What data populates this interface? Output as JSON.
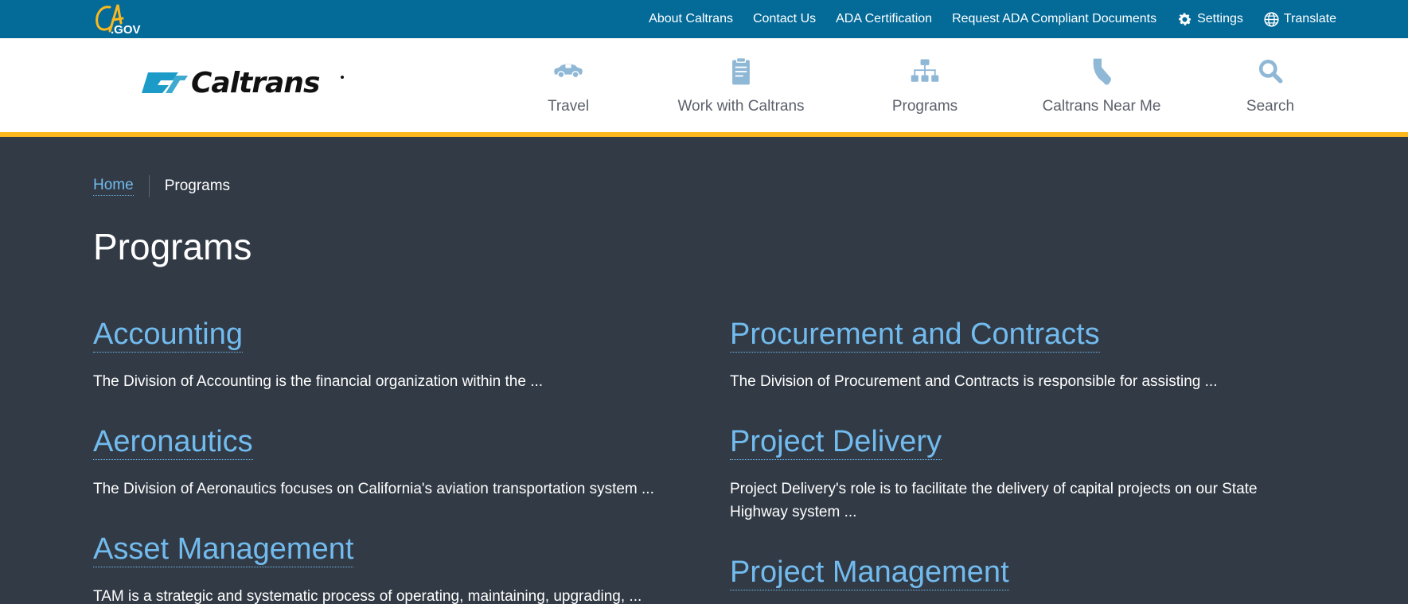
{
  "utility": {
    "links": [
      {
        "label": "About Caltrans"
      },
      {
        "label": "Contact Us"
      },
      {
        "label": "ADA Certification"
      },
      {
        "label": "Request ADA Compliant Documents"
      },
      {
        "label": "Settings",
        "icon": "gear-icon"
      },
      {
        "label": "Translate",
        "icon": "globe-icon"
      }
    ]
  },
  "colors": {
    "utility_bar": "#046b99",
    "gold_accent": "#fdb81e",
    "page_background": "#323a45",
    "link": "#72bbee",
    "nav_icon": "#8fb7d6"
  },
  "nav": {
    "items": [
      {
        "label": "Travel",
        "icon": "car-icon"
      },
      {
        "label": "Work with Caltrans",
        "icon": "clipboard-icon"
      },
      {
        "label": "Programs",
        "icon": "sitemap-icon"
      },
      {
        "label": "Caltrans Near Me",
        "icon": "california-icon"
      },
      {
        "label": "Search",
        "icon": "search-icon"
      }
    ]
  },
  "breadcrumb": {
    "home": "Home",
    "current": "Programs"
  },
  "page_title": "Programs",
  "programs": [
    {
      "title": "Accounting",
      "description": "The Division of Accounting is the financial organization within the ..."
    },
    {
      "title": "Aeronautics",
      "description": "The Division of Aeronautics focuses on California's aviation transportation system ..."
    },
    {
      "title": "Asset Management",
      "description": "TAM is a strategic and systematic process of operating, maintaining, upgrading, ..."
    },
    {
      "title": "Procurement and Contracts",
      "description": "The Division of Procurement and Contracts is responsible for assisting ..."
    },
    {
      "title": "Project Delivery",
      "description": "Project Delivery's role is to facilitate the delivery of capital projects on our State Highway system ..."
    },
    {
      "title": "Project Management",
      "description": ""
    }
  ]
}
